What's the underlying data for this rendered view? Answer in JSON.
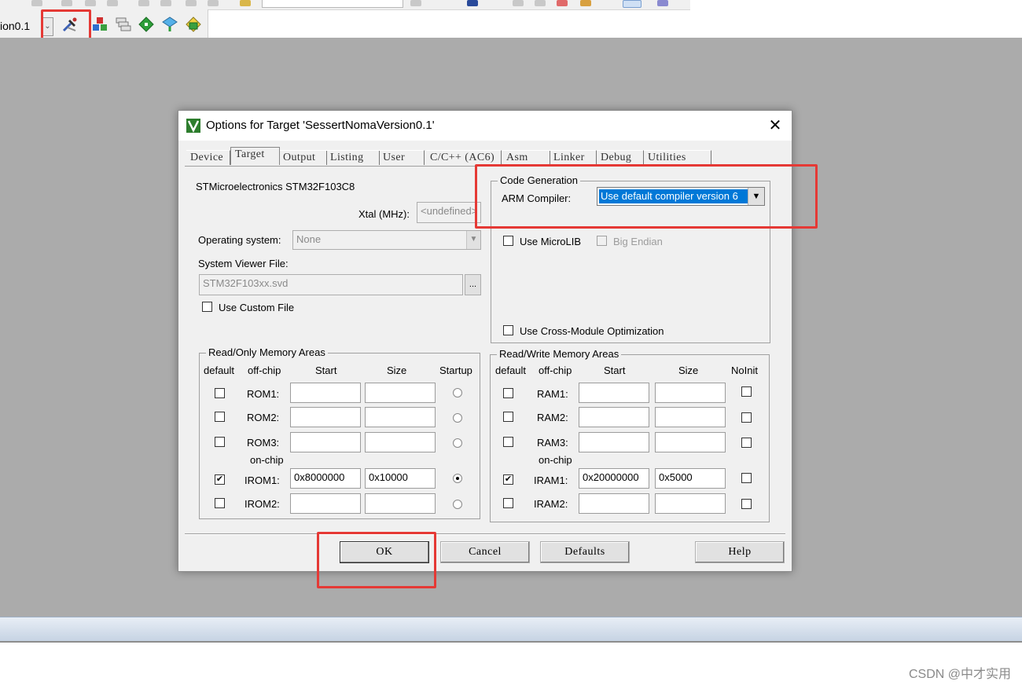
{
  "toolbar": {
    "target_name": "ion0.1",
    "icons": [
      "options-for-target-icon",
      "manage-project-items-icon",
      "select-packs-icon",
      "manage-run-time-environment-icon",
      "pack-installer-icon",
      "event-recorder-icon"
    ]
  },
  "dialog": {
    "title": "Options for Target 'SessertNomaVersion0.1'",
    "close_glyph": "✕",
    "tabs": [
      "Device",
      "Target",
      "Output",
      "Listing",
      "User",
      "C/C++ (AC6)",
      "Asm",
      "Linker",
      "Debug",
      "Utilities"
    ],
    "active_tab": "Target",
    "device_name": "STMicroelectronics STM32F103C8",
    "xtal_label": "Xtal (MHz):",
    "xtal_value": "<undefined>",
    "os_label": "Operating system:",
    "os_value": "None",
    "svd_label": "System Viewer File:",
    "svd_value": "STM32F103xx.svd",
    "svd_browse": "...",
    "use_custom_file_label": "Use Custom File",
    "code_generation": {
      "title": "Code Generation",
      "arm_compiler_label": "ARM Compiler:",
      "arm_compiler_value": "Use default compiler version 6",
      "use_microlib_label": "Use MicroLIB",
      "big_endian_label": "Big Endian",
      "cross_module_label": "Use Cross-Module Optimization"
    },
    "rom_areas": {
      "title": "Read/Only Memory Areas",
      "headers": [
        "default",
        "off-chip",
        "Start",
        "Size",
        "Startup"
      ],
      "on_chip_label": "on-chip",
      "rows": [
        {
          "label": "ROM1:",
          "start": "",
          "size": "",
          "default": false,
          "startup": false
        },
        {
          "label": "ROM2:",
          "start": "",
          "size": "",
          "default": false,
          "startup": false
        },
        {
          "label": "ROM3:",
          "start": "",
          "size": "",
          "default": false,
          "startup": false
        },
        {
          "label": "IROM1:",
          "start": "0x8000000",
          "size": "0x10000",
          "default": true,
          "startup": true
        },
        {
          "label": "IROM2:",
          "start": "",
          "size": "",
          "default": false,
          "startup": false
        }
      ]
    },
    "ram_areas": {
      "title": "Read/Write Memory Areas",
      "headers": [
        "default",
        "off-chip",
        "Start",
        "Size",
        "NoInit"
      ],
      "on_chip_label": "on-chip",
      "rows": [
        {
          "label": "RAM1:",
          "start": "",
          "size": "",
          "default": false,
          "noinit": false
        },
        {
          "label": "RAM2:",
          "start": "",
          "size": "",
          "default": false,
          "noinit": false
        },
        {
          "label": "RAM3:",
          "start": "",
          "size": "",
          "default": false,
          "noinit": false
        },
        {
          "label": "IRAM1:",
          "start": "0x20000000",
          "size": "0x5000",
          "default": true,
          "noinit": false
        },
        {
          "label": "IRAM2:",
          "start": "",
          "size": "",
          "default": false,
          "noinit": false
        }
      ]
    },
    "buttons": {
      "ok": "OK",
      "cancel": "Cancel",
      "defaults": "Defaults",
      "help": "Help"
    }
  },
  "watermark": "CSDN @中才实用",
  "colors": {
    "highlight_box": "#e53935",
    "selection": "#0078d7",
    "workspace": "#ababab"
  }
}
